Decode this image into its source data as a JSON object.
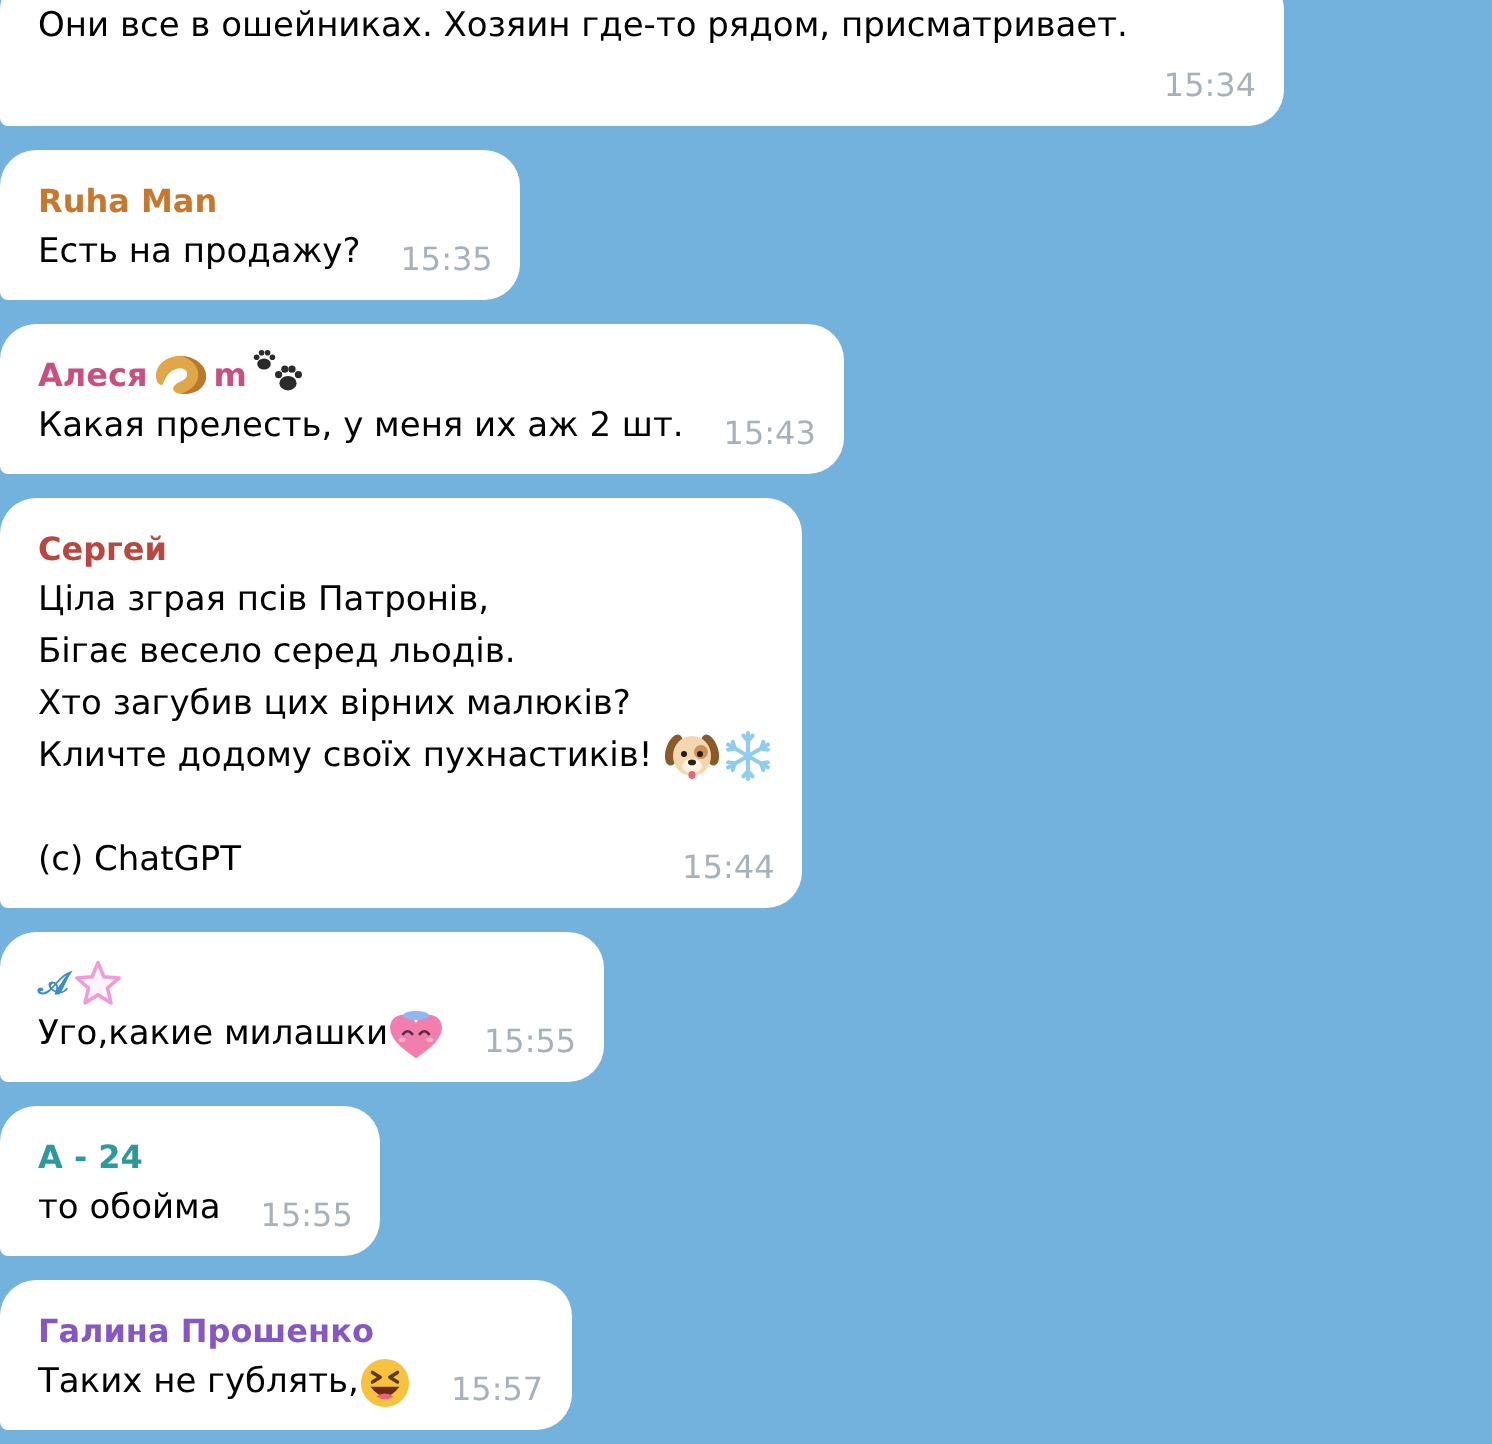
{
  "messages": [
    {
      "paragraphs": [
        {
          "lines": [
            {
              "parts": [
                {
                  "kind": "text",
                  "text": "Они все в ошейниках. Хозяин где-то рядом, присматривает."
                }
              ]
            }
          ]
        }
      ],
      "time": "15:34"
    },
    {
      "sender": {
        "color": "#c7782e",
        "parts": [
          {
            "kind": "text",
            "text": "Ruha Man"
          }
        ]
      },
      "paragraphs": [
        {
          "lines": [
            {
              "parts": [
                {
                  "kind": "text",
                  "text": "Есть на продажу?"
                }
              ]
            }
          ]
        }
      ],
      "time": "15:35"
    },
    {
      "sender": {
        "color": "#c94f80",
        "parts": [
          {
            "kind": "text",
            "text": "Алеся"
          },
          {
            "kind": "cookie"
          },
          {
            "kind": "text",
            "text": "m"
          },
          {
            "kind": "paws"
          }
        ]
      },
      "paragraphs": [
        {
          "lines": [
            {
              "parts": [
                {
                  "kind": "text",
                  "text": "Какая прелесть, у меня их аж 2 шт."
                }
              ]
            }
          ]
        }
      ],
      "time": "15:43"
    },
    {
      "sender": {
        "color": "#b9473f",
        "parts": [
          {
            "kind": "text",
            "text": "Сергей"
          }
        ]
      },
      "paragraphs": [
        {
          "lines": [
            {
              "parts": [
                {
                  "kind": "text",
                  "text": "Ціла зграя псів Патронів,"
                }
              ]
            },
            {
              "parts": [
                {
                  "kind": "text",
                  "text": "Бігає весело серед льодів."
                }
              ]
            },
            {
              "parts": [
                {
                  "kind": "text",
                  "text": "Хто загубив цих вірних малюків?"
                }
              ]
            },
            {
              "parts": [
                {
                  "kind": "text",
                  "text": "Кличте додому своїх пухнастиків!"
                },
                {
                  "kind": "dog"
                },
                {
                  "kind": "snowflake"
                }
              ]
            }
          ]
        },
        {
          "lines": [
            {
              "parts": [
                {
                  "kind": "text",
                  "text": "(c) ChatGPT"
                }
              ]
            }
          ]
        }
      ],
      "time": "15:44"
    },
    {
      "sender": {
        "color": "#3b8ec4",
        "parts": [
          {
            "kind": "text",
            "text": "𝒜"
          },
          {
            "kind": "star"
          }
        ]
      },
      "paragraphs": [
        {
          "lines": [
            {
              "parts": [
                {
                  "kind": "text",
                  "text": "Уго,какие милашки"
                },
                {
                  "kind": "heart"
                }
              ]
            }
          ]
        }
      ],
      "time": "15:55"
    },
    {
      "sender": {
        "color": "#2c9a9b",
        "parts": [
          {
            "kind": "text",
            "text": "А - 24"
          }
        ]
      },
      "paragraphs": [
        {
          "lines": [
            {
              "parts": [
                {
                  "kind": "text",
                  "text": "то обойма"
                }
              ]
            }
          ]
        }
      ],
      "time": "15:55"
    },
    {
      "sender": {
        "color": "#8656c4",
        "parts": [
          {
            "kind": "text",
            "text": "Галина Прошенко"
          }
        ]
      },
      "paragraphs": [
        {
          "lines": [
            {
              "parts": [
                {
                  "kind": "text",
                  "text": "Таких не гублять,"
                },
                {
                  "kind": "laugh"
                }
              ]
            }
          ]
        }
      ],
      "time": "15:57"
    }
  ]
}
